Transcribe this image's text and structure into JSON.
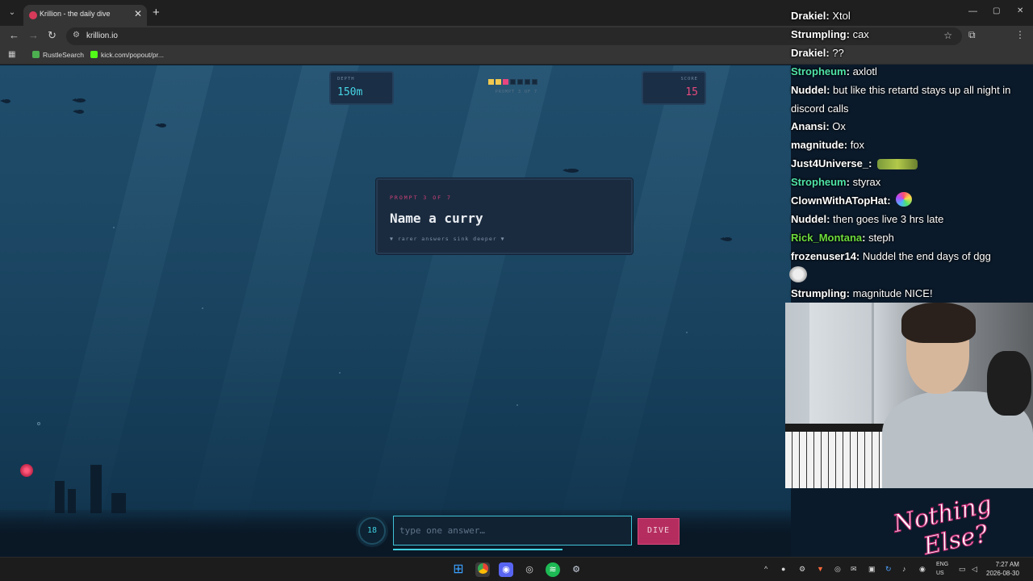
{
  "browser": {
    "tab_title": "Krillion - the daily dive",
    "tab_close": "✕",
    "new_tab": "+",
    "url": "krillion.io",
    "bookmarks": [
      {
        "label": "RustleSearch",
        "color": "#4caf50"
      },
      {
        "label": "kick.com/popout/pr...",
        "color": "#53fc18"
      }
    ],
    "window_controls": {
      "minimize": "—",
      "maximize": "▢",
      "close": "✕"
    }
  },
  "game": {
    "depth_label": "DEPTH",
    "depth_value": "150m",
    "score_label": "SCORE",
    "score_value": "15",
    "progress_label": "PROMPT 3 OF 7",
    "progress": {
      "total": 7,
      "completed": 2,
      "current": 3,
      "colors": {
        "done": "#f0c850",
        "current": "#e6457f"
      }
    },
    "prompt_kicker": "PROMPT 3 OF 7",
    "prompt_title": "Name a curry",
    "prompt_hint": "▼ rarer answers sink deeper ▼",
    "timer_value": "18",
    "input_placeholder": "type one answer…",
    "dive_label": "DIVE",
    "accent_cyan": "#3fd0e0",
    "accent_pink": "#e6457f"
  },
  "chat": {
    "messages": [
      {
        "user": "Drakiel",
        "text": "Xtol",
        "color": "#ffffff"
      },
      {
        "user": "Strumpling",
        "text": "cax",
        "color": "#ffffff"
      },
      {
        "user": "Drakiel",
        "text": "??",
        "color": "#ffffff"
      },
      {
        "user": "Stropheum",
        "text": "axlotl",
        "color": "#4fe3a8"
      },
      {
        "user": "Nuddel",
        "text": "but like this retartd stays up all night in discord calls",
        "color": "#ffffff"
      },
      {
        "user": "Anansi",
        "text": "Ox",
        "color": "#ffffff"
      },
      {
        "user": "magnitude",
        "text": "fox",
        "color": "#ffffff"
      },
      {
        "user": "Just4Universe_",
        "text": "",
        "color": "#ffffff"
      },
      {
        "user": "Stropheum",
        "text": "styrax",
        "color": "#4fe3a8"
      },
      {
        "user": "ClownWithATopHat",
        "text": "",
        "color": "#ffffff"
      },
      {
        "user": "Nuddel",
        "text": "then goes live 3 hrs late",
        "color": "#ffffff"
      },
      {
        "user": "Rick_Montana",
        "text": "steph",
        "color": "#6ddc3c"
      },
      {
        "user": "frozenuser14",
        "text": "Nuddel the end days of dgg",
        "color": "#ffffff"
      },
      {
        "user": "Strumpling",
        "text": "magnitude NICE!",
        "color": "#ffffff"
      }
    ]
  },
  "logo": {
    "line1": "Nothing",
    "line2": "Else?"
  },
  "taskbar": {
    "lang_line1": "ENG",
    "lang_line2": "US",
    "time": "7:27 AM",
    "date": "2026-08-30"
  }
}
